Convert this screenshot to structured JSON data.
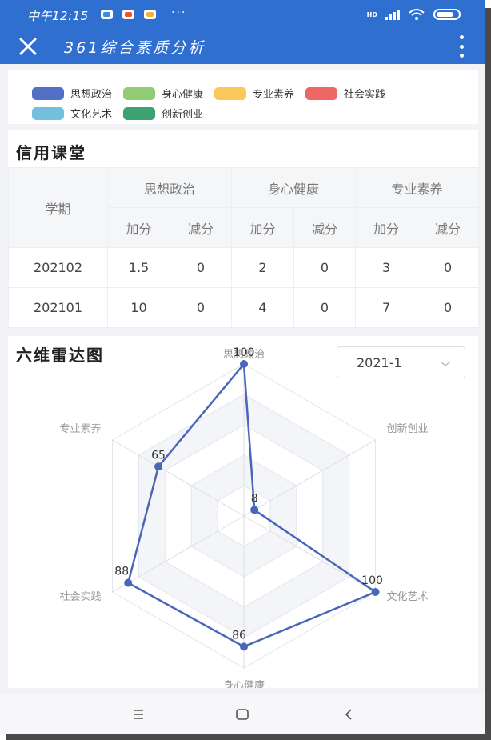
{
  "status_bar": {
    "time": "中午12:15",
    "dots": "···",
    "network": "HD",
    "icons": [
      "baidu-map-icon",
      "weibo-icon",
      "message-icon",
      "signal-icon",
      "wifi-icon",
      "battery-icon"
    ]
  },
  "app_bar": {
    "title": "361综合素质分析",
    "close_icon": "close-icon",
    "more_icon": "more-vertical-icon"
  },
  "legend": [
    {
      "label": "思想政治",
      "color": "#5470c6"
    },
    {
      "label": "身心健康",
      "color": "#91cc75"
    },
    {
      "label": "专业素养",
      "color": "#fac858"
    },
    {
      "label": "社会实践",
      "color": "#ee6666"
    },
    {
      "label": "文化艺术",
      "color": "#73c0de"
    },
    {
      "label": "创新创业",
      "color": "#3ba272"
    }
  ],
  "credit": {
    "title": "信用课堂",
    "term_header": "学期",
    "groups": [
      "思想政治",
      "身心健康",
      "专业素养"
    ],
    "add_label": "加分",
    "sub_label": "减分",
    "rows": [
      {
        "term": "202102",
        "values": [
          "1.5",
          "0",
          "2",
          "0",
          "3",
          "0"
        ]
      },
      {
        "term": "202101",
        "values": [
          "10",
          "0",
          "4",
          "0",
          "7",
          "0"
        ]
      }
    ]
  },
  "radar": {
    "title": "六维雷达图",
    "selected_term": "2021-1",
    "select_icon": "chevron-down-icon"
  },
  "chart_data": {
    "type": "radar",
    "indicators": [
      {
        "name": "思想政治",
        "max": 100
      },
      {
        "name": "创新创业",
        "max": 100
      },
      {
        "name": "文化艺术",
        "max": 100
      },
      {
        "name": "身心健康",
        "max": 100
      },
      {
        "name": "社会实践",
        "max": 100
      },
      {
        "name": "专业素养",
        "max": 100
      }
    ],
    "series": [
      {
        "values": [
          100,
          8,
          100,
          86,
          88,
          65
        ],
        "color": "#4a66b8"
      }
    ],
    "grid": true
  },
  "nav_bar": {
    "icons": [
      "menu-icon",
      "home-icon",
      "back-icon"
    ]
  }
}
